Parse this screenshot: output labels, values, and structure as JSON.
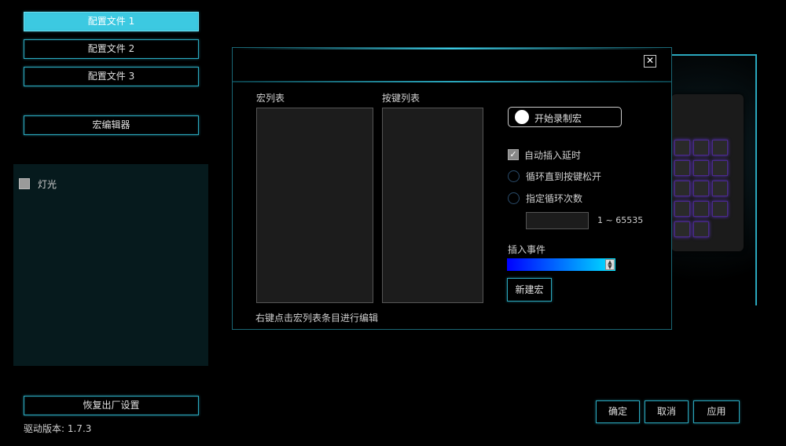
{
  "sidebar": {
    "profiles": [
      {
        "label": "配置文件 1",
        "active": true
      },
      {
        "label": "配置文件 2",
        "active": false
      },
      {
        "label": "配置文件 3",
        "active": false
      }
    ],
    "macro_editor_label": "宏编辑器",
    "light_label": "灯光",
    "restore_label": "恢复出厂设置",
    "driver_version": "驱动版本: 1.7.3"
  },
  "dialog": {
    "close_glyph": "✕",
    "macro_list_label": "宏列表",
    "key_list_label": "按键列表",
    "hint": "右键点击宏列表条目进行编辑",
    "record_label": "开始录制宏",
    "options": {
      "auto_delay": "自动插入延时",
      "loop_until_release": "循环直到按键松开",
      "loop_count": "指定循环次数",
      "range_hint": "1 ~ 65535"
    },
    "insert_event_label": "插入事件",
    "new_macro_label": "新建宏"
  },
  "footer": {
    "ok_label": "确定",
    "cancel_label": "取消",
    "apply_label": "应用"
  },
  "colors": {
    "accent": "#2aa7bd",
    "active_tab": "#3cc9e1",
    "panel": "#061a1d"
  }
}
